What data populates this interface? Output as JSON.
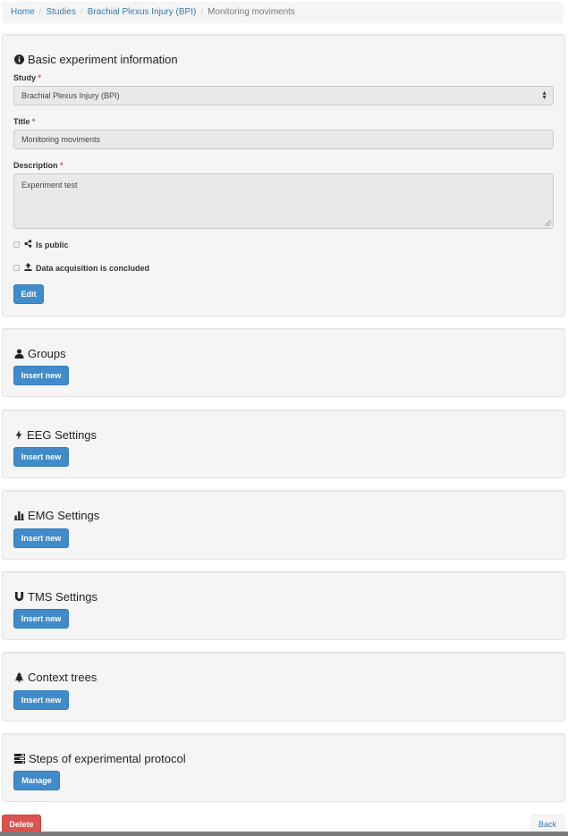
{
  "breadcrumb": {
    "items": [
      "Home",
      "Studies",
      "Brachial Plexus Injury (BPI)"
    ],
    "current": "Monitoring moviments",
    "separator": "/"
  },
  "basic_info": {
    "title": "Basic experiment information",
    "icon": "info-circle-icon",
    "study_label": "Study",
    "study_value": "Brachial Plexus Injury (BPI)",
    "title_label": "Title",
    "title_value": "Monitoring moviments",
    "description_label": "Description",
    "description_value": "Experiment test",
    "required_mark": "*",
    "is_public_label": "Is public",
    "is_public_checked": false,
    "data_acq_label": "Data acquisition is concluded",
    "data_acq_checked": false,
    "edit_button": "Edit"
  },
  "sections": [
    {
      "title": "Groups",
      "icon": "user-icon",
      "button": "Insert new"
    },
    {
      "title": "EEG Settings",
      "icon": "flash-icon",
      "button": "Insert new"
    },
    {
      "title": "EMG Settings",
      "icon": "bar-chart-icon",
      "button": "Insert new"
    },
    {
      "title": "TMS Settings",
      "icon": "magnet-icon",
      "button": "Insert new"
    },
    {
      "title": "Context trees",
      "icon": "tree-icon",
      "button": "Insert new"
    },
    {
      "title": "Steps of experimental protocol",
      "icon": "tasks-icon",
      "button": "Manage"
    }
  ],
  "footer": {
    "delete_button": "Delete",
    "back_button": "Back"
  },
  "colors": {
    "primary": "#428bca",
    "danger": "#d9534f",
    "link": "#337ab7",
    "panel_bg": "#f5f5f5"
  }
}
